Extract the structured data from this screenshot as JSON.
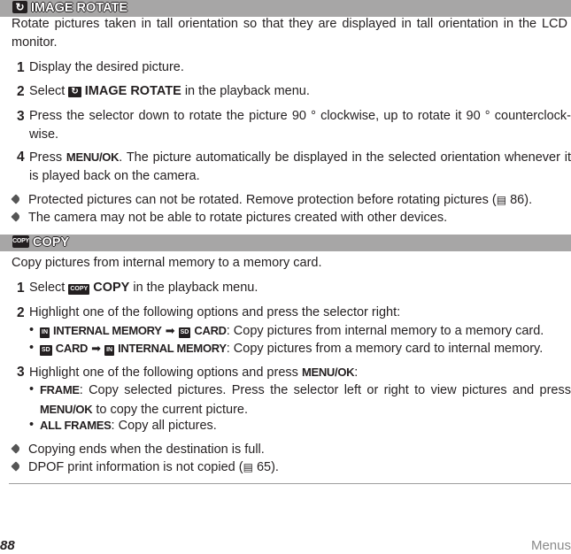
{
  "rotate": {
    "heading": "IMAGE ROTATE",
    "icon": "rotate-icon",
    "intro": "Rotate pictures taken in tall orientation so that they are displayed in tall orientation in the LCD monitor.",
    "steps": [
      {
        "num": "1",
        "text": "Display the desired picture."
      },
      {
        "num": "2",
        "pre": "Select",
        "bold": "IMAGE ROTATE",
        "post": "in the playback menu."
      },
      {
        "num": "3",
        "text": "Press the selector down to rotate the picture 90 ° clockwise, up to rotate it 90 ° counterclock-wise."
      },
      {
        "num": "4",
        "pre": "Press",
        "bold": "MENU/OK",
        "post": ".  The picture automatically be displayed in the selected orientation whenever it is played back on the camera."
      }
    ],
    "notes": [
      {
        "pre": "Protected pictures can not be rotated.  Remove protection before rotating pictures (",
        "ref": "86",
        "post": ")."
      },
      {
        "text": "The camera may not be able to rotate pictures created with other devices."
      }
    ]
  },
  "copy": {
    "heading": "COPY",
    "icon_label": "COPY",
    "intro": "Copy pictures from internal memory to a memory card.",
    "steps": [
      {
        "num": "1",
        "pre": "Select",
        "bold": "COPY",
        "post": "in the playback menu."
      },
      {
        "num": "2",
        "text": "Highlight one of the following options and press the selector right:",
        "options": [
          {
            "from_icon": "IN",
            "from": "INTERNAL MEMORY",
            "to_icon": "SD",
            "to": "CARD",
            "desc": ": Copy pictures from internal memory to a memory card."
          },
          {
            "from_icon": "SD",
            "from": "CARD",
            "to_icon": "IN",
            "to": "INTERNAL MEMORY",
            "desc": ": Copy pictures from a memory card to internal memory."
          }
        ]
      },
      {
        "num": "3",
        "pre": "Highlight one of the following options and press",
        "bold": "MENU/OK",
        "post": ":",
        "options": [
          {
            "label": "FRAME",
            "desc": ": Copy selected pictures.  Press the selector left or right to view pictures and press",
            "bold2": "MENU/OK",
            "desc2": "to copy the current picture."
          },
          {
            "label": "ALL FRAMES",
            "desc": ": Copy all pictures."
          }
        ]
      }
    ],
    "notes": [
      {
        "text": "Copying ends when the destination is full."
      },
      {
        "pre": "DPOF print information is not copied (",
        "ref": "65",
        "post": ")."
      }
    ]
  },
  "footer": {
    "page_number": "88",
    "section": "Menus"
  },
  "symbols": {
    "arrow": "➡",
    "bullet": "•",
    "book": "▤",
    "rotate": "↻"
  }
}
